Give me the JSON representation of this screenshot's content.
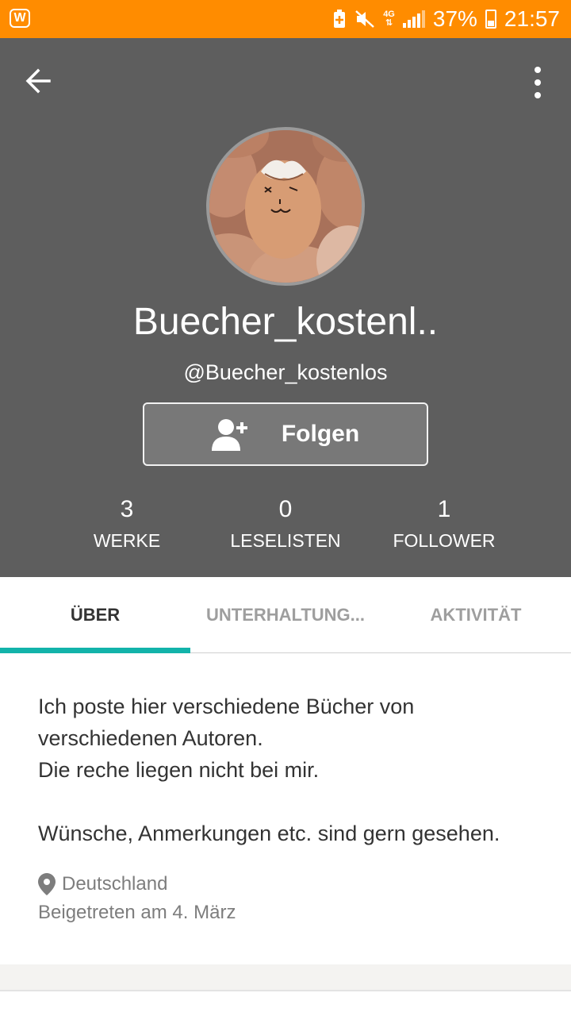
{
  "status_bar": {
    "app_icon": "W",
    "network": "4G",
    "battery": "37%",
    "time": "21:57",
    "color": "#ff8c00"
  },
  "header": {
    "back_icon": "arrow-left-icon",
    "menu_icon": "more-vertical-icon",
    "display_name": "Buecher_kostenl..",
    "username": "@Buecher_kostenlos",
    "follow_label": "Folgen",
    "background": "#5e5e5e",
    "stats": [
      {
        "value": "3",
        "label": "WERKE"
      },
      {
        "value": "0",
        "label": "LESELISTEN"
      },
      {
        "value": "1",
        "label": "FOLLOWER"
      }
    ]
  },
  "tabs": [
    {
      "label": "ÜBER",
      "active": true
    },
    {
      "label": "UNTERHALTUNG...",
      "active": false
    },
    {
      "label": "AKTIVITÄT",
      "active": false
    }
  ],
  "tab_accent": "#12b3aa",
  "about": {
    "text": "Ich poste hier verschiedene Bücher von verschiedenen Autoren.\nDie reche liegen nicht bei mir.\n\nWünsche, Anmerkungen etc. sind gern gesehen.",
    "location": "Deutschland",
    "joined": "Beigetreten am 4. März"
  }
}
